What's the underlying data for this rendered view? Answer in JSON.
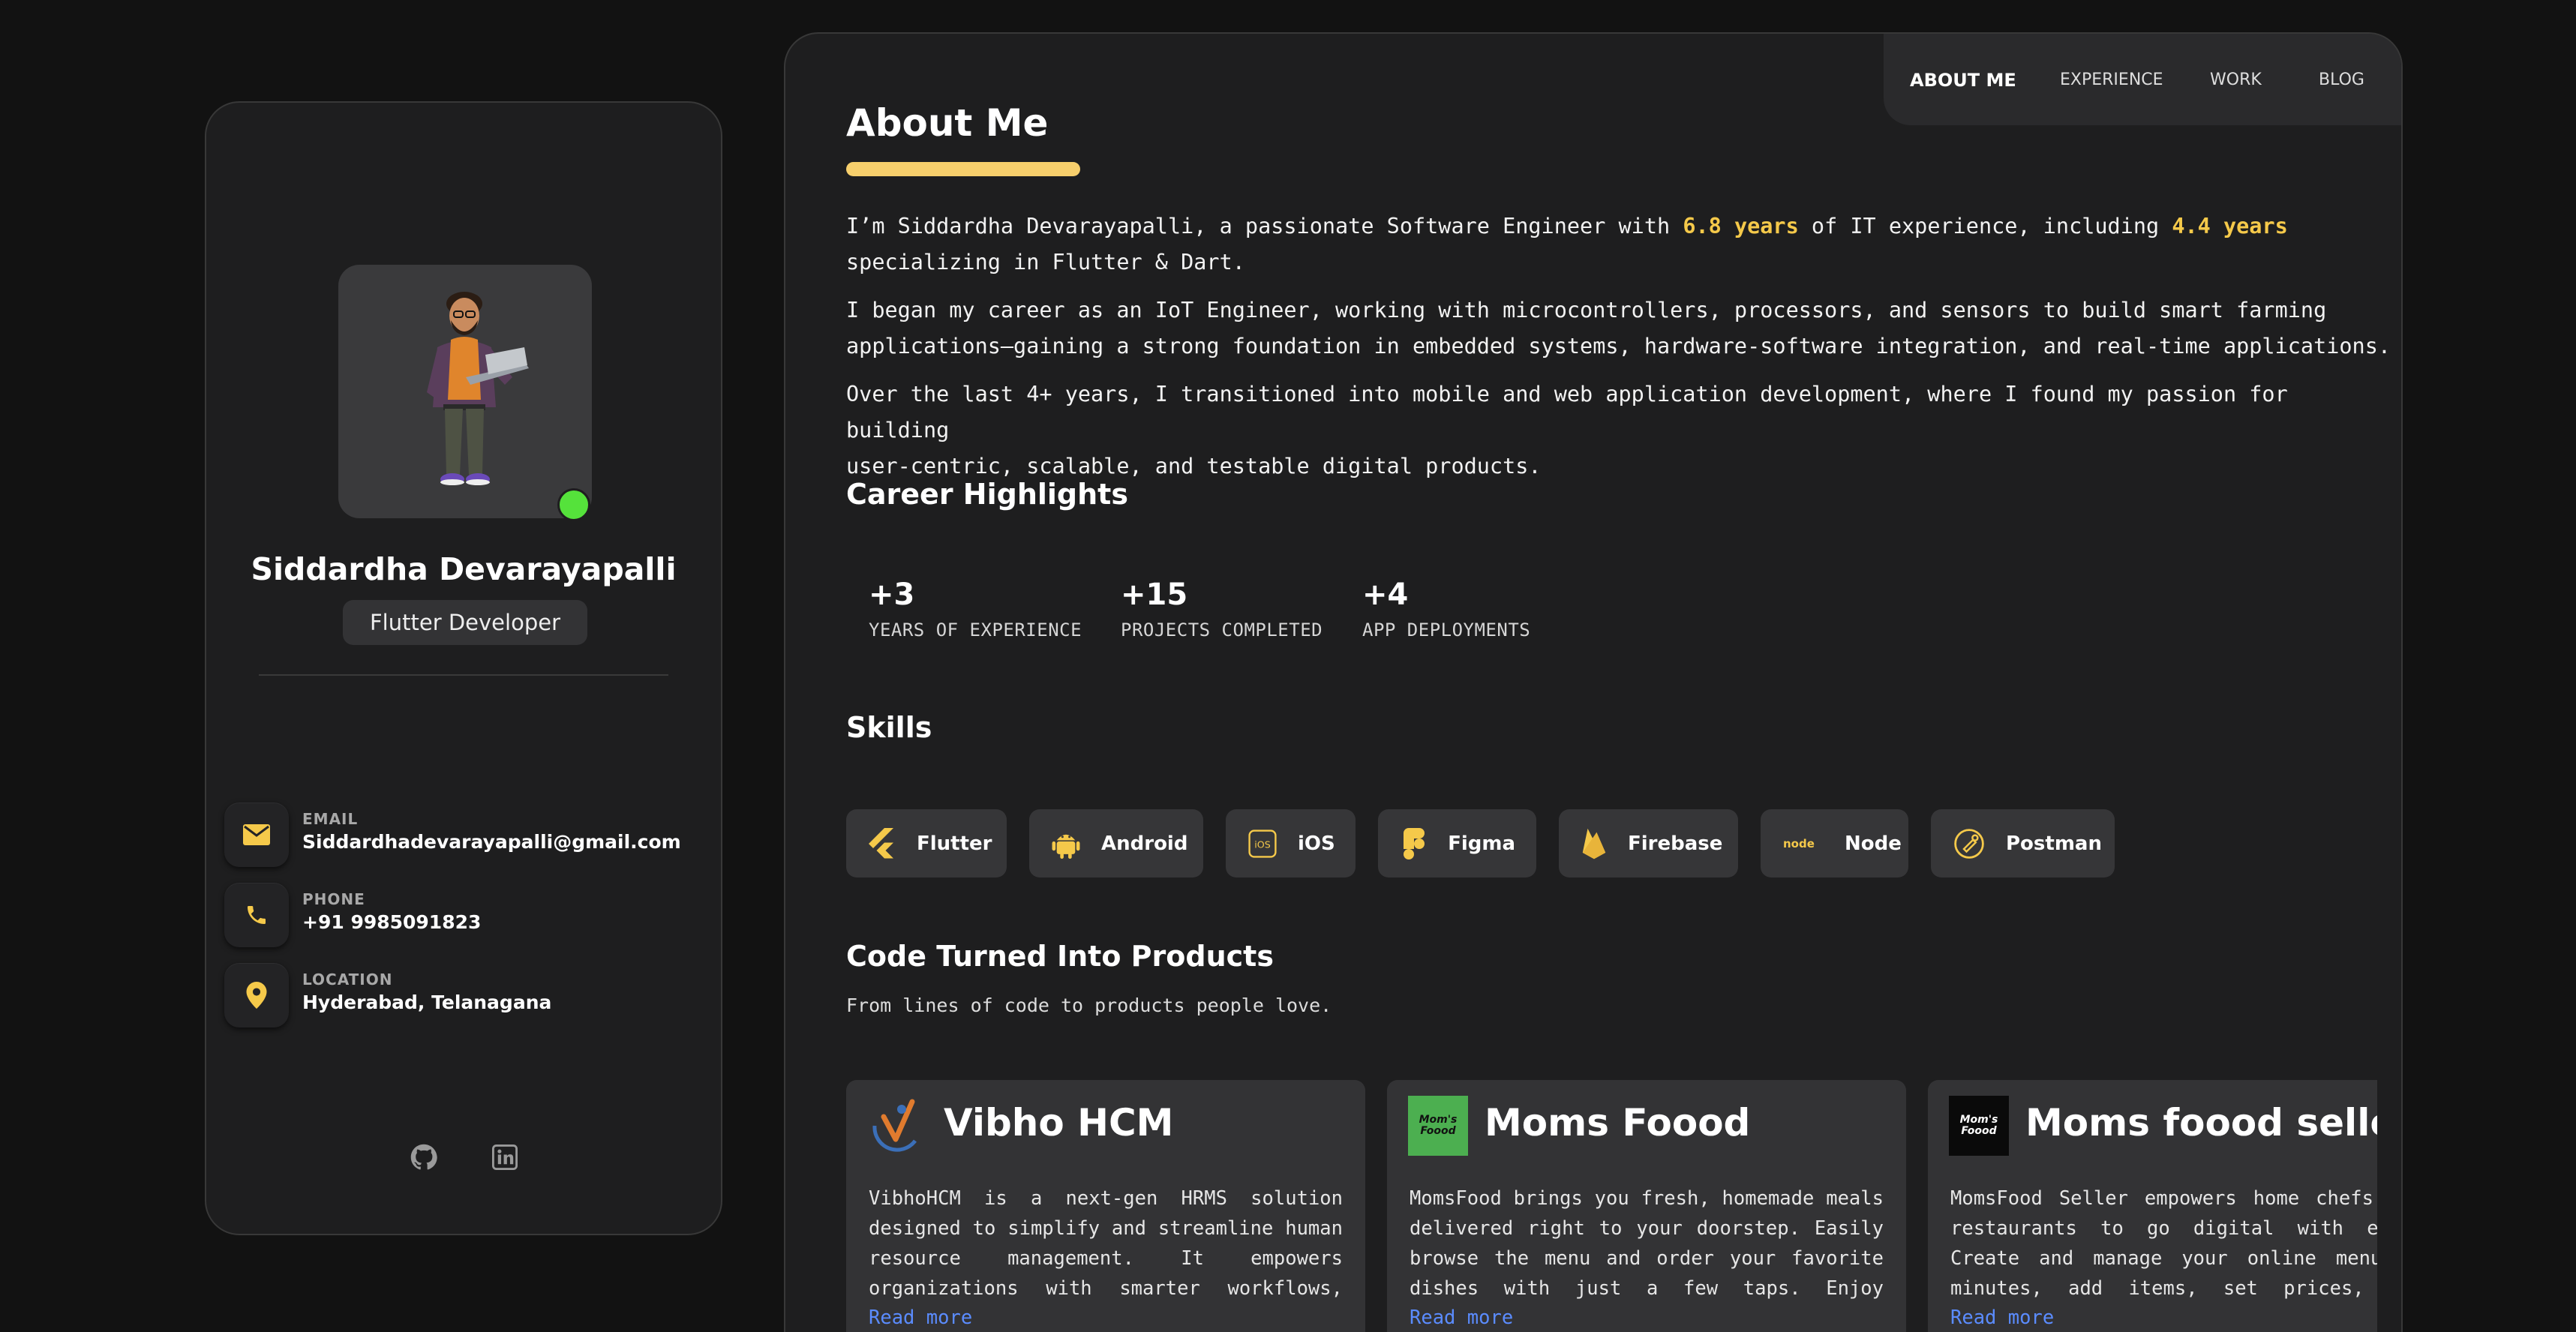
{
  "profile": {
    "name": "Siddardha Devarayapalli",
    "role": "Flutter Developer",
    "status_color": "#55e23b"
  },
  "contacts": [
    {
      "label": "EMAIL",
      "value": "Siddardhadevarayapalli@gmail.com",
      "icon": "mail-icon"
    },
    {
      "label": "PHONE",
      "value": "+91 9985091823",
      "icon": "phone-icon"
    },
    {
      "label": "LOCATION",
      "value": "Hyderabad, Telanagana",
      "icon": "location-pin-icon"
    }
  ],
  "socials": [
    "github-icon",
    "linkedin-icon"
  ],
  "nav": {
    "items": [
      "ABOUT ME",
      "EXPERIENCE",
      "WORK",
      "BLOG"
    ],
    "active": "ABOUT ME"
  },
  "about": {
    "title": "About Me",
    "p1_a": "I’m Siddardha Devarayapalli, a passionate Software Engineer with ",
    "p1_h1": "6.8 years",
    "p1_b": " of IT experience, including ",
    "p1_h2": "4.4 years",
    "p1_c": "specializing in Flutter & Dart.",
    "p2_line1": "I began my career as an IoT Engineer, working with microcontrollers, processors, and sensors to build smart farming",
    "p2_line2": "applications—gaining a strong foundation in embedded systems, hardware-software integration, and real-time applications.",
    "p3_line1": "Over the last 4+ years, I transitioned into mobile and web application development, where I found my passion for building",
    "p3_line2": "user-centric, scalable, and testable digital products."
  },
  "highlights": {
    "title": "Career Highlights",
    "items": [
      {
        "num": "+3",
        "label": "YEARS OF EXPERIENCE"
      },
      {
        "num": "+15",
        "label": "PROJECTS COMPLETED"
      },
      {
        "num": "+4",
        "label": "APP DEPLOYMENTS"
      }
    ]
  },
  "skills": {
    "title": "Skills",
    "items": [
      "Flutter",
      "Android",
      "iOS",
      "Figma",
      "Firebase",
      "Node",
      "Postman"
    ],
    "icon_color": "#f5c94a"
  },
  "products": {
    "title": "Code Turned Into Products",
    "subtitle": "From lines of code to products people love.",
    "read_more": "Read more",
    "items": [
      {
        "name": "Vibho HCM",
        "logo_text": "",
        "desc": "VibhoHCM is a next-gen HRMS solution designed to simplify and streamline human resource management. It empowers organizations with smarter workflows, high…"
      },
      {
        "name": "Moms Foood",
        "logo_text": "Mom's Foood",
        "desc": "MomsFood brings you fresh, homemade meals delivered right to your doorstep. Easily browse the menu and order your favorite dishes with just a few taps. Enjoy healthy…"
      },
      {
        "name": "Moms foood seller",
        "logo_text": "Mom's Foood",
        "desc": "MomsFood Seller empowers home chefs and restaurants to go digital with ease. Create and manage your online menu in minutes, add items, set prices, and update descriptions…"
      }
    ]
  },
  "colors": {
    "accent": "#f7cf6c",
    "highlight": "#f5c94a",
    "link": "#5b8cff",
    "card_bg": "#1e1e1f"
  }
}
